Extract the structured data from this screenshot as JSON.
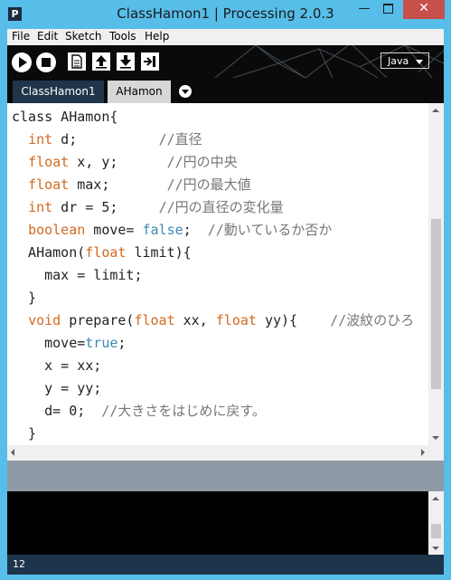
{
  "window": {
    "title": "ClassHamon1 | Processing 2.0.3",
    "app_icon_letter": "P",
    "minimize_glyph": "—",
    "close_glyph": "✕",
    "frame_color": "#57bde9"
  },
  "menu": [
    "File",
    "Edit",
    "Sketch",
    "Tools",
    "Help"
  ],
  "toolbar": {
    "buttons": [
      "run",
      "stop",
      "new",
      "open",
      "save",
      "export"
    ],
    "mode": "Java"
  },
  "tabs": [
    {
      "label": "ClassHamon1",
      "active": false
    },
    {
      "label": "AHamon",
      "active": true
    }
  ],
  "editor": {
    "lines": [
      [
        {
          "t": "class AHamon{",
          "c": "plain"
        }
      ],
      [
        {
          "t": "  ",
          "c": "plain"
        },
        {
          "t": "int",
          "c": "kw"
        },
        {
          "t": " d;          ",
          "c": "plain"
        },
        {
          "t": "//直径",
          "c": "cm"
        }
      ],
      [
        {
          "t": "  ",
          "c": "plain"
        },
        {
          "t": "float",
          "c": "kw"
        },
        {
          "t": " x, y;      ",
          "c": "plain"
        },
        {
          "t": "//円の中央",
          "c": "cm"
        }
      ],
      [
        {
          "t": "  ",
          "c": "plain"
        },
        {
          "t": "float",
          "c": "kw"
        },
        {
          "t": " max;       ",
          "c": "plain"
        },
        {
          "t": "//円の最大値",
          "c": "cm"
        }
      ],
      [
        {
          "t": "  ",
          "c": "plain"
        },
        {
          "t": "int",
          "c": "kw"
        },
        {
          "t": " dr = 5;     ",
          "c": "plain"
        },
        {
          "t": "//円の直径の変化量",
          "c": "cm"
        }
      ],
      [
        {
          "t": "  ",
          "c": "plain"
        },
        {
          "t": "boolean",
          "c": "kw"
        },
        {
          "t": " move= ",
          "c": "plain"
        },
        {
          "t": "false",
          "c": "lit"
        },
        {
          "t": ";  ",
          "c": "plain"
        },
        {
          "t": "//動いているか否か",
          "c": "cm"
        }
      ],
      [
        {
          "t": "  AHamon(",
          "c": "plain"
        },
        {
          "t": "float",
          "c": "kw"
        },
        {
          "t": " limit){",
          "c": "plain"
        }
      ],
      [
        {
          "t": "    max = limit;",
          "c": "plain"
        }
      ],
      [
        {
          "t": "  }",
          "c": "plain"
        }
      ],
      [
        {
          "t": "  ",
          "c": "plain"
        },
        {
          "t": "void",
          "c": "kw"
        },
        {
          "t": " prepare(",
          "c": "plain"
        },
        {
          "t": "float",
          "c": "kw"
        },
        {
          "t": " xx, ",
          "c": "plain"
        },
        {
          "t": "float",
          "c": "kw"
        },
        {
          "t": " yy){    ",
          "c": "plain"
        },
        {
          "t": "//波紋のひろ",
          "c": "cm"
        }
      ],
      [
        {
          "t": "    move=",
          "c": "plain"
        },
        {
          "t": "true",
          "c": "lit"
        },
        {
          "t": ";",
          "c": "plain"
        }
      ],
      [
        {
          "t": "    x = xx;",
          "c": "plain"
        }
      ],
      [
        {
          "t": "    y = yy;",
          "c": "plain"
        }
      ],
      [
        {
          "t": "    d= 0;  ",
          "c": "plain"
        },
        {
          "t": "//大きさをはじめに戻す。",
          "c": "cm"
        }
      ],
      [
        {
          "t": "  }",
          "c": "plain"
        }
      ]
    ],
    "colors": {
      "keyword": "#d2691e",
      "literal": "#3d88b2",
      "comment": "#777777"
    }
  },
  "status": {
    "line_number": "12"
  }
}
